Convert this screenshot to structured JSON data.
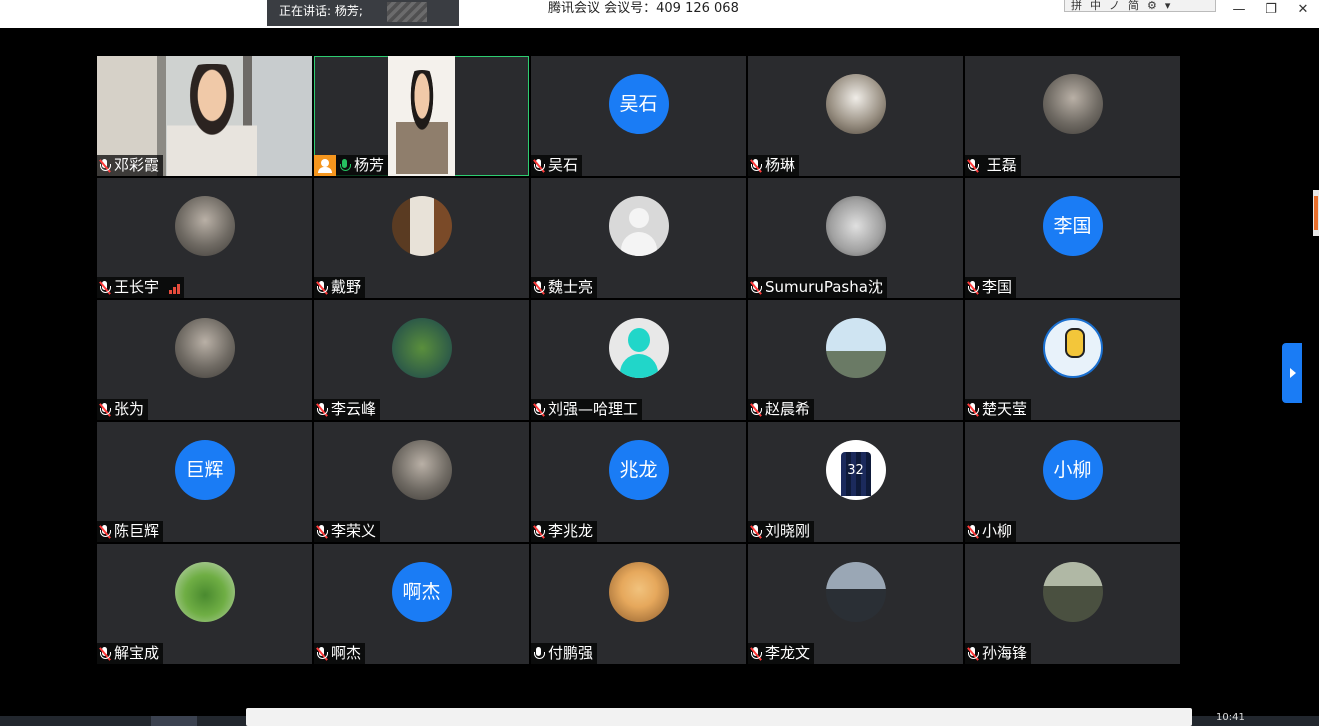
{
  "titlebar": {
    "speaking_label": "正在讲话: 杨芳;",
    "meeting_title": "腾讯会议 会议号：409 126 068",
    "ime_items": [
      "拼",
      "中",
      "ノ",
      "简",
      "⚙",
      "▾"
    ]
  },
  "window_controls": {
    "minimize": "—",
    "restore": "❐",
    "close": "✕"
  },
  "participants": [
    {
      "name": "邓彩霞",
      "mic": "muted",
      "view": "video"
    },
    {
      "name": "杨芳",
      "mic": "active",
      "view": "video",
      "host": true,
      "active_speaker": true
    },
    {
      "name": "吴石",
      "mic": "muted",
      "view": "text-avatar",
      "avatar_text": "吴石"
    },
    {
      "name": "杨琳",
      "mic": "muted",
      "view": "photo-avatar",
      "avatar_icon": "trees-photo"
    },
    {
      "name": " 王磊",
      "mic": "muted",
      "view": "photo-avatar",
      "avatar_icon": "portrait-photo"
    },
    {
      "name": "王长宇",
      "mic": "muted",
      "view": "photo-avatar",
      "avatar_icon": "portrait-photo",
      "signal_weak": true
    },
    {
      "name": "戴野",
      "mic": "muted",
      "view": "photo-avatar",
      "avatar_icon": "room-photo"
    },
    {
      "name": "魏士亮",
      "mic": "muted",
      "view": "default-avatar",
      "avatar_icon": "gray-user"
    },
    {
      "name": "SumuruPasha沈",
      "mic": "muted",
      "view": "photo-avatar",
      "avatar_icon": "face-photo"
    },
    {
      "name": "李国",
      "mic": "muted",
      "view": "text-avatar",
      "avatar_text": "李国"
    },
    {
      "name": "张为",
      "mic": "muted",
      "view": "photo-avatar",
      "avatar_icon": "family-photo"
    },
    {
      "name": "李云峰",
      "mic": "muted",
      "view": "photo-avatar",
      "avatar_icon": "grinch-photo"
    },
    {
      "name": "刘强—哈理工",
      "mic": "muted",
      "view": "default-avatar",
      "avatar_icon": "cyan-user"
    },
    {
      "name": "赵晨希",
      "mic": "muted",
      "view": "photo-avatar",
      "avatar_icon": "outdoor-photo"
    },
    {
      "name": "楚天莹",
      "mic": "muted",
      "view": "photo-avatar",
      "avatar_icon": "cartoon-photo"
    },
    {
      "name": "陈巨辉",
      "mic": "muted",
      "view": "text-avatar",
      "avatar_text": "巨辉"
    },
    {
      "name": "李荣义",
      "mic": "muted",
      "view": "photo-avatar",
      "avatar_icon": "portrait-photo"
    },
    {
      "name": "李兆龙",
      "mic": "muted",
      "view": "text-avatar",
      "avatar_text": "兆龙"
    },
    {
      "name": "刘晓刚",
      "mic": "muted",
      "view": "photo-avatar",
      "avatar_icon": "jersey-photo"
    },
    {
      "name": "小柳",
      "mic": "muted",
      "view": "text-avatar",
      "avatar_text": "小柳"
    },
    {
      "name": "解宝成",
      "mic": "muted",
      "view": "photo-avatar",
      "avatar_icon": "plant-photo"
    },
    {
      "name": "啊杰",
      "mic": "muted",
      "view": "text-avatar",
      "avatar_text": "啊杰"
    },
    {
      "name": "付鹏强",
      "mic": "on",
      "view": "photo-avatar",
      "avatar_icon": "kid-photo"
    },
    {
      "name": "李龙文",
      "mic": "muted",
      "view": "photo-avatar",
      "avatar_icon": "car-photo"
    },
    {
      "name": "孙海锋",
      "mic": "muted",
      "view": "photo-avatar",
      "avatar_icon": "group-photo"
    }
  ],
  "taskbar": {
    "time": "10:41"
  },
  "colors": {
    "tile_bg": "#2a2b2e",
    "accent_blue": "#1a7cf5",
    "active_green": "#2ecc71",
    "mic_active": "#25c160",
    "mute_red": "#ff3b3b"
  }
}
